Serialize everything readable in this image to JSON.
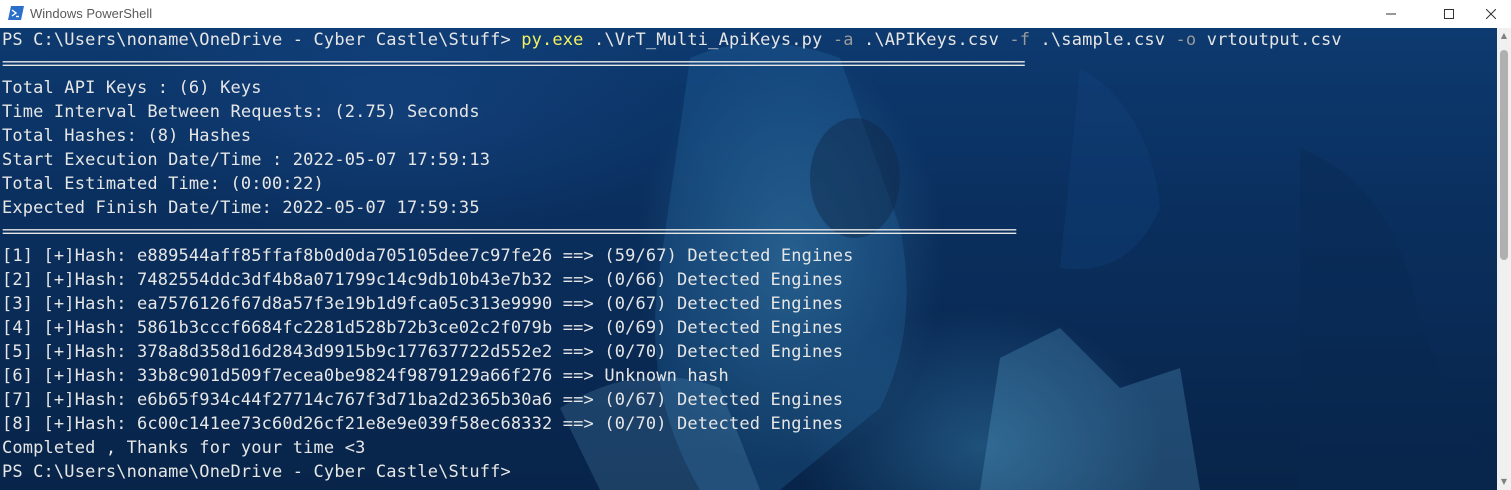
{
  "window": {
    "title": "Windows PowerShell",
    "icon": "powershell-icon"
  },
  "command": {
    "prompt": "PS C:\\Users\\noname\\OneDrive - Cyber Castle\\Stuff> ",
    "exe": "py.exe",
    "script": " .\\VrT_Multi_ApiKeys.py ",
    "flag_a": "-a",
    "arg_a": " .\\APIKeys.csv ",
    "flag_f": "-f",
    "arg_f": " .\\sample.csv ",
    "flag_o": "-o",
    "arg_o": " vrtoutput.csv"
  },
  "separator1": "========================================================================================================================",
  "summary": [
    "Total API Keys : (6) Keys",
    "Time Interval Between Requests: (2.75) Seconds",
    "Total Hashes: (8) Hashes",
    "Start Execution Date/Time : 2022-05-07 17:59:13",
    "Total Estimated Time: (0:00:22)",
    "Expected Finish Date/Time: 2022-05-07 17:59:35"
  ],
  "separator2": "=======================================================================================================================",
  "results": [
    "[1] [+]Hash: e889544aff85ffaf8b0d0da705105dee7c97fe26 ==> (59/67) Detected Engines",
    "[2] [+]Hash: 7482554ddc3df4b8a071799c14c9db10b43e7b32 ==> (0/66) Detected Engines",
    "[3] [+]Hash: ea7576126f67d8a57f3e19b1d9fca05c313e9990 ==> (0/67) Detected Engines",
    "[4] [+]Hash: 5861b3cccf6684fc2281d528b72b3ce02c2f079b ==> (0/69) Detected Engines",
    "[5] [+]Hash: 378a8d358d16d2843d9915b9c177637722d552e2 ==> (0/70) Detected Engines",
    "[6] [+]Hash: 33b8c901d509f7ecea0be9824f9879129a66f276 ==> Unknown hash",
    "[7] [+]Hash: e6b65f934c44f27714c767f3d71ba2d2365b30a6 ==> (0/67) Detected Engines",
    "[8] [+]Hash: 6c00c141ee73c60d26cf21e8e9e039f58ec68332 ==> (0/70) Detected Engines"
  ],
  "completed": "Completed , Thanks for your time <3",
  "final_prompt": "PS C:\\Users\\noname\\OneDrive - Cyber Castle\\Stuff>",
  "colors": {
    "command": "#f2f261",
    "flag": "#9a9a9a",
    "text": "#e6e6e6",
    "background": "#0b2a55"
  }
}
